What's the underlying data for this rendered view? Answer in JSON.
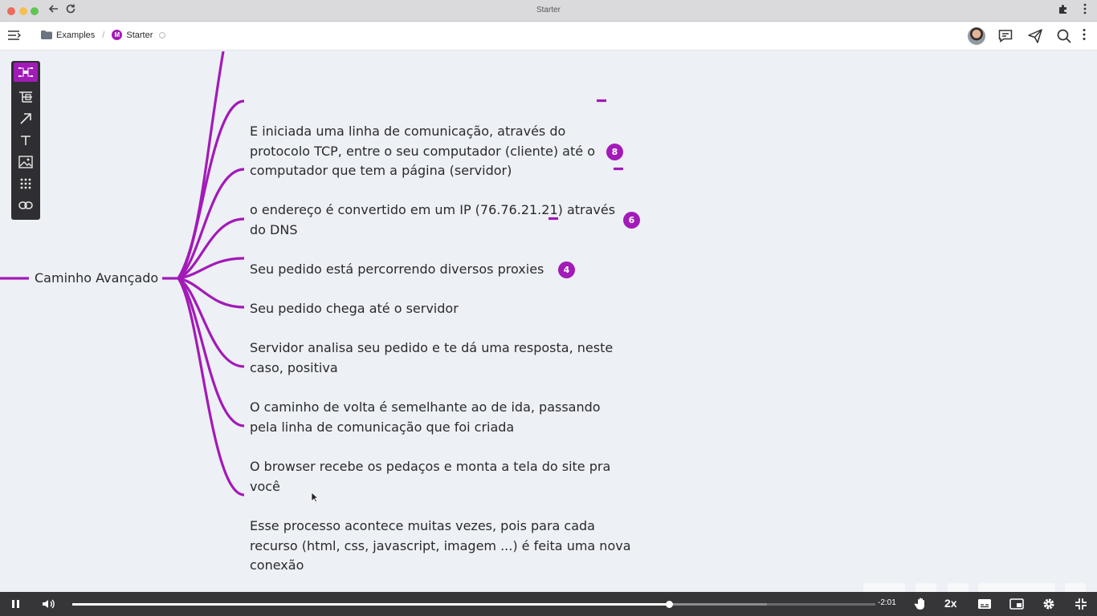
{
  "window": {
    "title": "Starter"
  },
  "header": {
    "breadcrumb": {
      "folder": "Examples",
      "separator": "/",
      "document": "Starter",
      "document_badge": "M"
    },
    "icons": [
      "menu-icon",
      "avatar",
      "comments-icon",
      "share-icon",
      "search-icon",
      "more-vertical-icon"
    ]
  },
  "toolbar": {
    "tools": [
      "mindmap-layout-icon",
      "structure-icon",
      "arrow-icon",
      "text-icon",
      "image-icon",
      "grid-icon",
      "link-icon"
    ]
  },
  "mindmap": {
    "root": "Caminho Avançado",
    "branch_color": "#a21ab8",
    "children": [
      {
        "lines": [
          "E iniciada uma linha de comunicação, através do",
          "protocolo TCP, entre o seu computador (cliente) até o",
          "computador que tem a página (servidor)"
        ],
        "badge": "8"
      },
      {
        "lines": [
          "o endereço é convertido em um IP (76.76.21.21) através",
          "do DNS"
        ],
        "badge": "6"
      },
      {
        "lines": [
          "Seu pedido está percorrendo diversos proxies"
        ],
        "badge": "4"
      },
      {
        "lines": [
          "Seu pedido chega até o servidor"
        ],
        "badge": null
      },
      {
        "lines": [
          "Servidor analisa seu pedido e te dá uma resposta, neste",
          "caso, positiva"
        ],
        "badge": null
      },
      {
        "lines": [
          "O caminho de volta é semelhante ao de ida, passando",
          "pela linha de comunicação que foi criada"
        ],
        "badge": null
      },
      {
        "lines": [
          "O browser recebe os pedaços e monta a tela do site pra",
          "você"
        ],
        "badge": null
      },
      {
        "lines": [
          "Esse processo acontece muitas vezes, pois para cada",
          "recurso (html, css, javascript, imagem ...) é feita uma nova",
          "conexão"
        ],
        "badge": null
      }
    ]
  },
  "player": {
    "time_remaining": "-2:01",
    "speed": "2x",
    "progress_fraction": 0.743,
    "buffered_fraction": 0.865
  }
}
